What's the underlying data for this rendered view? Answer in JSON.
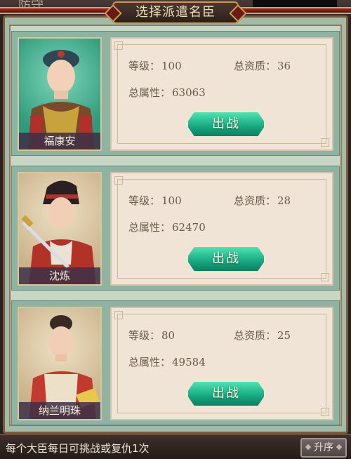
{
  "header": {
    "title": "选择派遣名臣",
    "background_text": "防守"
  },
  "ministers": [
    {
      "name": "福康安",
      "level_label": "等级：",
      "level": "100",
      "aptitude_label": "总资质：",
      "aptitude": "36",
      "attr_label": "总属性：",
      "attr": "63063",
      "button": "出战",
      "bg": "teal"
    },
    {
      "name": "沈炼",
      "level_label": "等级：",
      "level": "100",
      "aptitude_label": "总资质：",
      "aptitude": "28",
      "attr_label": "总属性：",
      "attr": "62470",
      "button": "出战",
      "bg": "sand"
    },
    {
      "name": "纳兰明珠",
      "level_label": "等级：",
      "level": "80",
      "aptitude_label": "总资质：",
      "aptitude": "25",
      "attr_label": "总属性：",
      "attr": "49584",
      "button": "出战",
      "bg": "sand"
    }
  ],
  "footer": {
    "note": "每个大臣每日可挑战或复仇1次",
    "sort_label": "升序"
  },
  "colors": {
    "accent_green": "#16a77f",
    "panel": "#a6b8a6",
    "title_red": "#9a2a22"
  }
}
